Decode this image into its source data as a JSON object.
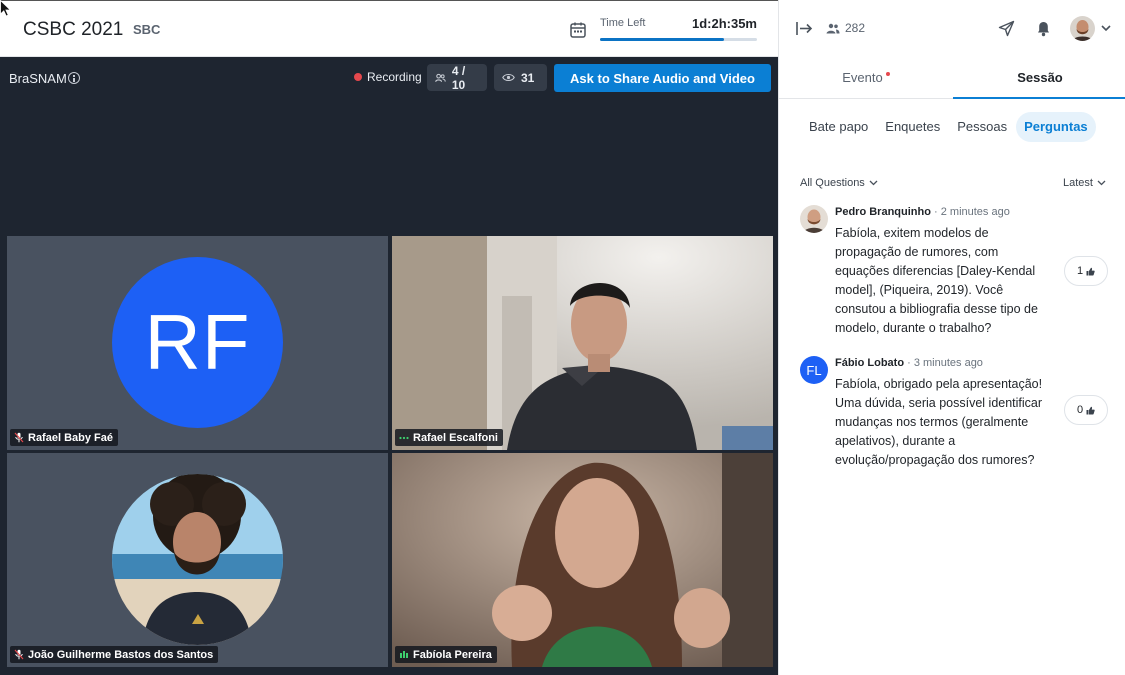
{
  "header": {
    "app_title": "CSBC 2021",
    "org": "SBC",
    "time_left_label": "Time Left",
    "time_left_value": "1d:2h:35m",
    "time_progress": 0.79
  },
  "stage": {
    "room_name": "BraSNAM",
    "recording_label": "Recording",
    "participants": "4 / 10",
    "viewers": "31",
    "share_button": "Ask to Share Audio and Video",
    "tiles": [
      {
        "name": "Rafael Baby Faé",
        "initials": "RF",
        "status_icon": "mic-muted-icon"
      },
      {
        "name": "Rafael Escalfoni",
        "status_icon": "ellipsis-icon"
      },
      {
        "name": "João Guilherme Bastos dos Santos",
        "status_icon": "mic-muted-icon"
      },
      {
        "name": "Fabíola Pereira",
        "status_icon": "audio-level-icon"
      }
    ]
  },
  "panel": {
    "attendees_count": "282",
    "tabs": [
      "Evento",
      "Sessão"
    ],
    "subtabs": [
      "Bate papo",
      "Enquetes",
      "Pessoas",
      "Perguntas"
    ],
    "filter_left": "All Questions",
    "filter_right": "Latest",
    "questions": [
      {
        "author": "Pedro Branquinho",
        "time": "· 2 minutes ago",
        "text": "Fabíola, exitem modelos de propagação de rumores, com equações diferencias [Daley-Kendal model], (Piqueira, 2019). Você consutou a bibliografia desse tipo de modelo, durante o trabalho?",
        "votes": "1"
      },
      {
        "author": "Fábio Lobato",
        "initials": "FL",
        "time": "· 3 minutes ago",
        "text": "Fabíola, obrigado pela apresentação! Uma dúvida, seria possível identificar mudanças nos termos (geralmente apelativos), durante a evolução/propagação dos rumores?",
        "votes": "0"
      }
    ]
  },
  "colors": {
    "accent": "#0b7fd4",
    "stage_bg": "#1e2530",
    "tile_bg": "#495260",
    "avatar_blue": "#1d60f5",
    "recording_red": "#e5484d"
  }
}
